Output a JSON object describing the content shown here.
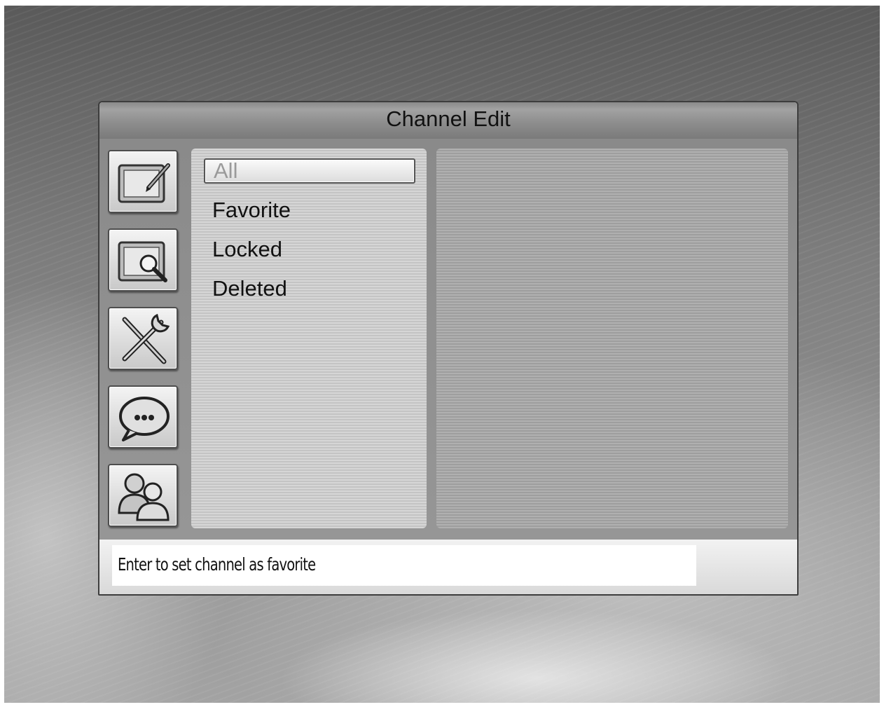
{
  "dialog": {
    "title": "Channel Edit"
  },
  "sidebar": {
    "items": [
      {
        "icon": "edit-icon"
      },
      {
        "icon": "magnify-icon"
      },
      {
        "icon": "tools-icon"
      },
      {
        "icon": "chat-icon"
      },
      {
        "icon": "users-icon"
      }
    ]
  },
  "channel_list": {
    "selected_index": 0,
    "items": [
      {
        "label": "All"
      },
      {
        "label": "Favorite"
      },
      {
        "label": "Locked"
      },
      {
        "label": "Deleted"
      }
    ]
  },
  "status": {
    "hint": "Enter to set channel as favorite"
  }
}
